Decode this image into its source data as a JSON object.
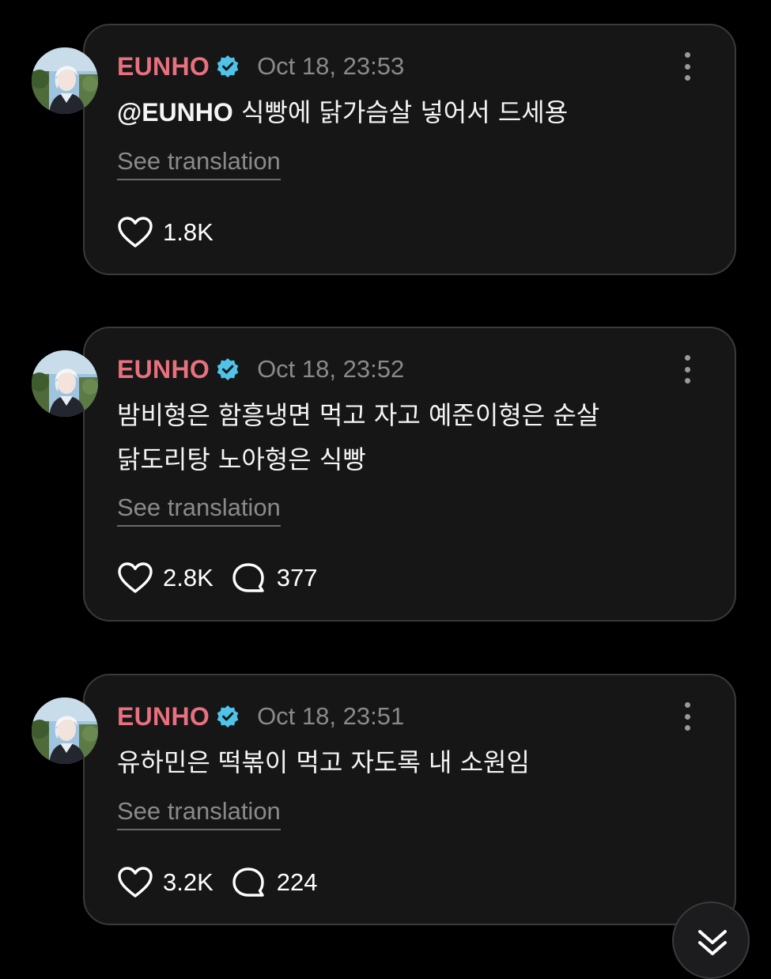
{
  "posts": [
    {
      "username": "EUNHO",
      "timestamp": "Oct 18, 23:53",
      "mention": "@EUNHO",
      "text_lines": [
        "식빵에 닭가슴살 넣어서 드세용"
      ],
      "translate_label": "See translation",
      "likes": "1.8K",
      "replies": null
    },
    {
      "username": "EUNHO",
      "timestamp": "Oct 18, 23:52",
      "mention": "",
      "text_lines": [
        "밤비형은 함흥냉면 먹고 자고 예준이형은 순살",
        "닭도리탕 노아형은 식빵"
      ],
      "translate_label": "See translation",
      "likes": "2.8K",
      "replies": "377"
    },
    {
      "username": "EUNHO",
      "timestamp": "Oct 18, 23:51",
      "mention": "",
      "text_lines": [
        "유하민은 떡볶이 먹고 자도록 내 소원임"
      ],
      "translate_label": "See translation",
      "likes": "3.2K",
      "replies": "224"
    }
  ],
  "colors": {
    "background": "#000000",
    "card": "#161616",
    "username": "#e8707f",
    "verified": "#4fc3e8",
    "muted": "#8a8a8a"
  },
  "icons": {
    "verified": "verified-badge-icon",
    "more": "more-vertical-icon",
    "like": "heart-icon",
    "reply": "speech-bubble-icon",
    "scroll": "double-chevron-down-icon"
  }
}
